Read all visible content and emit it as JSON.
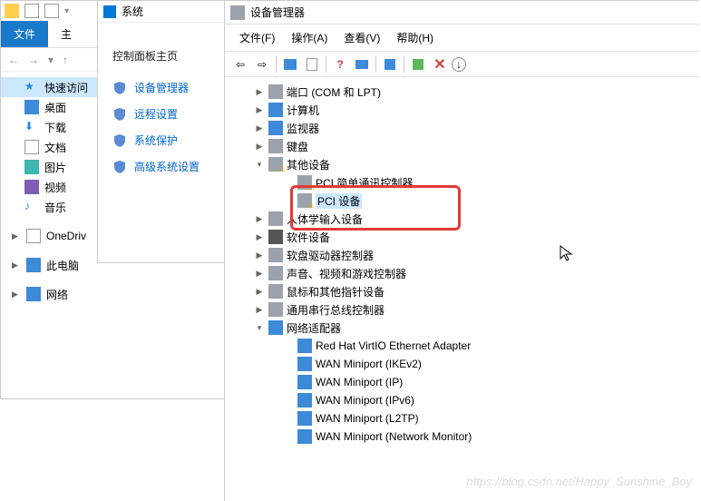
{
  "fe": {
    "tabs": {
      "file": "文件",
      "home": "主"
    },
    "items": {
      "quick": "快速访问",
      "desktop": "桌面",
      "downloads": "下载",
      "documents": "文档",
      "pictures": "图片",
      "videos": "视频",
      "music": "音乐",
      "onedrive": "OneDriv",
      "thispc": "此电脑",
      "network": "网络"
    }
  },
  "cp": {
    "title": "系统",
    "home": "控制面板主页",
    "links": {
      "devmgr": "设备管理器",
      "remote": "远程设置",
      "sysprotect": "系统保护",
      "advanced": "高级系统设置"
    }
  },
  "dm": {
    "title": "设备管理器",
    "menu": {
      "file": "文件(F)",
      "action": "操作(A)",
      "view": "查看(V)",
      "help": "帮助(H)"
    },
    "nodes": {
      "ports": "端口 (COM 和 LPT)",
      "computer": "计算机",
      "monitors": "监视器",
      "keyboards": "键盘",
      "other": "其他设备",
      "pci_comm": "PCI 简单通讯控制器",
      "pci_dev": "PCI 设备",
      "hid": "人体学输入设备",
      "software": "软件设备",
      "floppy": "软盘驱动器控制器",
      "sound": "声音、视频和游戏控制器",
      "mouse": "鼠标和其他指针设备",
      "usb": "通用串行总线控制器",
      "netadapters": "网络适配器",
      "net_virtio": "Red Hat VirtIO Ethernet Adapter",
      "net_ikev2": "WAN Miniport (IKEv2)",
      "net_ip": "WAN Miniport (IP)",
      "net_ipv6": "WAN Miniport (IPv6)",
      "net_l2tp": "WAN Miniport (L2TP)",
      "net_monitor": "WAN Miniport (Network Monitor)"
    }
  },
  "watermark": "https://blog.csdn.net/Happy_Sunshine_Boy"
}
